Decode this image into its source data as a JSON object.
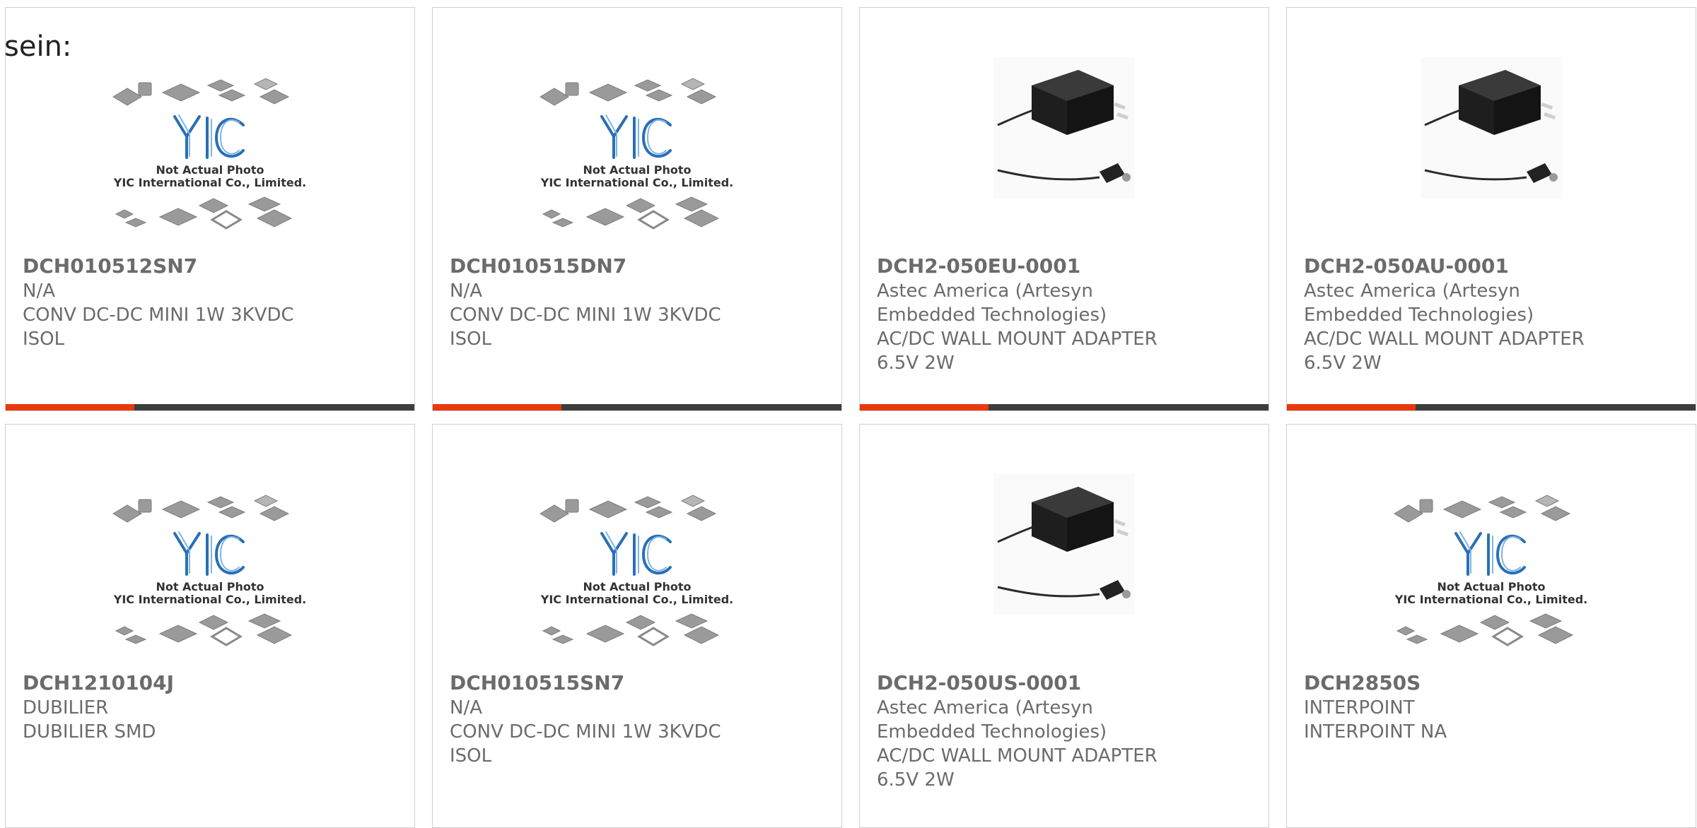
{
  "intro_text": "sein:",
  "placeholder": {
    "caption_line1": "Not Actual Photo",
    "caption_line2": "YIC International Co., Limited.",
    "logo_text": "YIC"
  },
  "accent_color": "#e8380d",
  "products": [
    {
      "part": "DCH010512SN7",
      "lines": [
        "N/A",
        "CONV DC-DC MINI 1W 3KVDC",
        "ISOL"
      ],
      "image": "placeholder",
      "bar": true
    },
    {
      "part": "DCH010515DN7",
      "lines": [
        "N/A",
        "CONV DC-DC MINI 1W 3KVDC",
        "ISOL"
      ],
      "image": "placeholder",
      "bar": true
    },
    {
      "part": "DCH2-050EU-0001",
      "lines": [
        "Astec America (Artesyn",
        "Embedded Technologies)",
        "AC/DC WALL MOUNT ADAPTER",
        "6.5V 2W"
      ],
      "image": "adapter",
      "bar": true
    },
    {
      "part": "DCH2-050AU-0001",
      "lines": [
        "Astec America (Artesyn",
        "Embedded Technologies)",
        "AC/DC WALL MOUNT ADAPTER",
        "6.5V 2W"
      ],
      "image": "adapter",
      "bar": true
    },
    {
      "part": "DCH1210104J",
      "lines": [
        "DUBILIER",
        "DUBILIER SMD"
      ],
      "image": "placeholder",
      "bar": false
    },
    {
      "part": "DCH010515SN7",
      "lines": [
        "N/A",
        "CONV DC-DC MINI 1W 3KVDC",
        "ISOL"
      ],
      "image": "placeholder",
      "bar": false
    },
    {
      "part": "DCH2-050US-0001",
      "lines": [
        "Astec America (Artesyn",
        "Embedded Technologies)",
        "AC/DC WALL MOUNT ADAPTER",
        "6.5V 2W"
      ],
      "image": "adapter",
      "bar": false
    },
    {
      "part": "DCH2850S",
      "lines": [
        "INTERPOINT",
        "INTERPOINT NA"
      ],
      "image": "placeholder",
      "bar": false
    }
  ]
}
